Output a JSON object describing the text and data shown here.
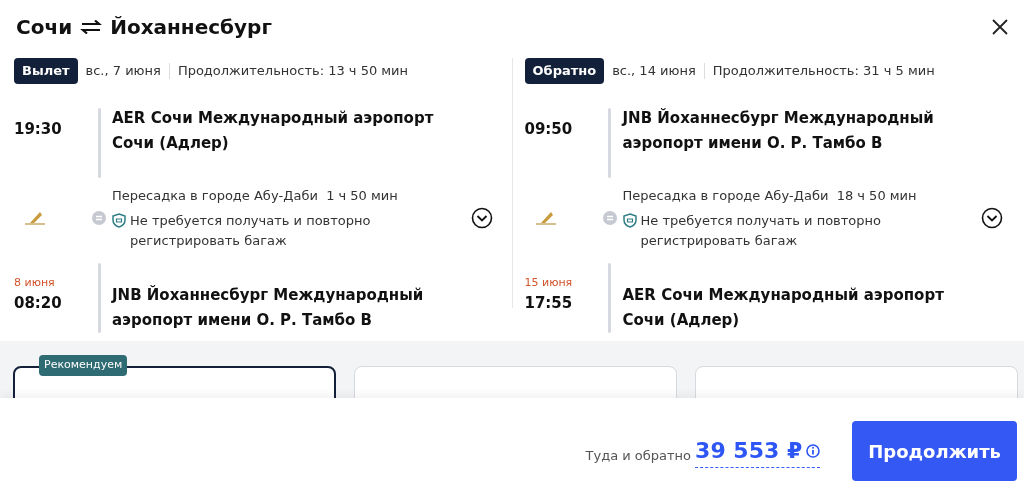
{
  "title": {
    "from": "Сочи",
    "to": "Йоханнесбург"
  },
  "legs": [
    {
      "badge": "Вылет",
      "date": "вс., 7 июня",
      "duration": "Продолжительность: 13 ч 50 мин",
      "departure": {
        "time": "19:30",
        "airport": "AER Сочи Международный аэропорт Сочи (Адлер)"
      },
      "transfer": {
        "city": "Пересадка в городе Абу-Даби",
        "wait": "1 ч 50 мин",
        "note": "Не требуется получать и повторно регистрировать багаж"
      },
      "arrival": {
        "date": "8 июня",
        "time": "08:20",
        "airport": "JNB Йоханнесбург Международный аэропорт имени О. Р. Тамбо В"
      }
    },
    {
      "badge": "Обратно",
      "date": "вс., 14 июня",
      "duration": "Продолжительность: 31 ч 5 мин",
      "departure": {
        "time": "09:50",
        "airport": "JNB Йоханнесбург Международный аэропорт имени О. Р. Тамбо В"
      },
      "transfer": {
        "city": "Пересадка в городе Абу-Даби",
        "wait": "18 ч 50 мин",
        "note": "Не требуется получать и повторно регистрировать багаж"
      },
      "arrival": {
        "date": "15 июня",
        "time": "17:55",
        "airport": "AER Сочи Международный аэропорт Сочи (Адлер)"
      }
    }
  ],
  "fares": [
    {
      "badge": "Рекомендуем",
      "selected": true
    },
    {
      "selected": false
    },
    {
      "selected": false
    }
  ],
  "footer": {
    "label": "Туда и обратно",
    "price": "39 553 ₽",
    "button": "Продолжить"
  }
}
